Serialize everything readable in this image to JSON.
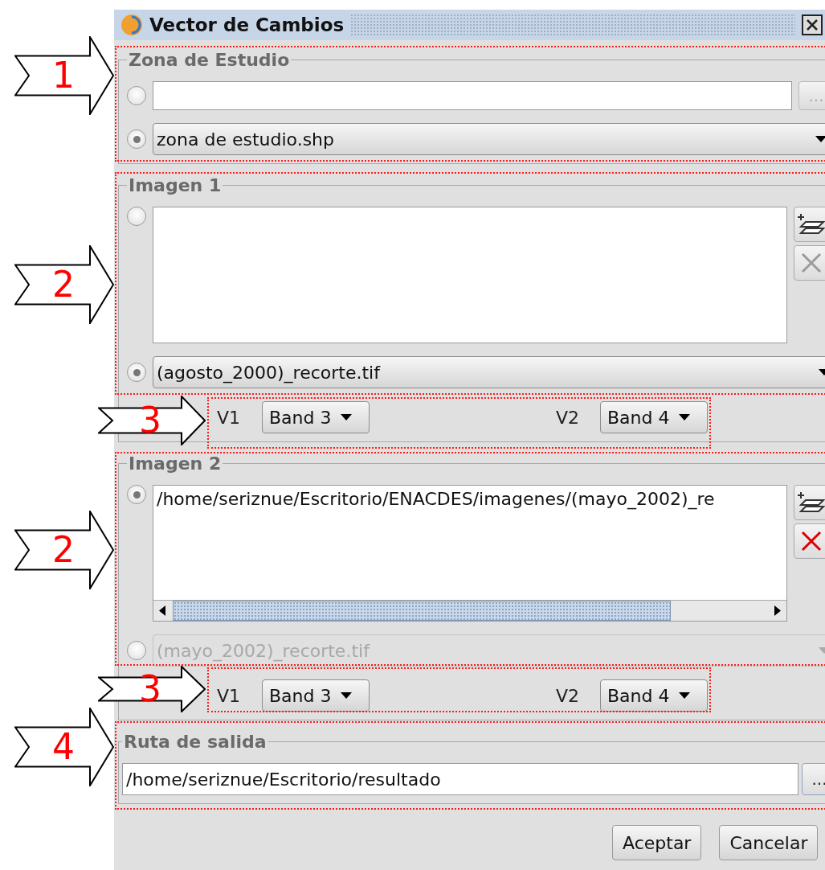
{
  "window": {
    "title": "Vector de Cambios"
  },
  "study_zone": {
    "title": "Zona de Estudio",
    "options": [
      {
        "kind": "file",
        "selected": false,
        "button": {
          "label": "...",
          "disabled": true
        }
      },
      {
        "kind": "combo",
        "selected": true,
        "value": "zona de estudio.shp"
      }
    ]
  },
  "images": [
    {
      "title": "Imagen 1",
      "list": {
        "selected": false,
        "remove_enabled": false,
        "scrollbar": false
      },
      "combo": {
        "selected": true,
        "disabled": false,
        "value": "(agosto_2000)_recorte.tif"
      },
      "bands": [
        {
          "label": "V1",
          "value": "Band 3"
        },
        {
          "label": "V2",
          "value": "Band 4"
        }
      ]
    },
    {
      "title": "Imagen 2",
      "list": {
        "selected": true,
        "remove_enabled": true,
        "scrollbar": true,
        "items": [
          "/home/seriznue/Escritorio/ENACDES/imagenes/(mayo_2002)_re"
        ]
      },
      "combo": {
        "selected": false,
        "disabled": true,
        "value": "(mayo_2002)_recorte.tif"
      },
      "bands": [
        {
          "label": "V1",
          "value": "Band 3"
        },
        {
          "label": "V2",
          "value": "Band 4"
        }
      ]
    }
  ],
  "output": {
    "title": "Ruta de salida",
    "value": "/home/seriznue/Escritorio/resultado",
    "button": {
      "label": "...",
      "disabled": false
    }
  },
  "buttons": [
    {
      "label": "Aceptar"
    },
    {
      "label": "Cancelar"
    }
  ],
  "annotations": [
    {
      "label": "1"
    },
    {
      "label": "2"
    },
    {
      "label": "3"
    },
    {
      "label": "2"
    },
    {
      "label": "3"
    },
    {
      "label": "4"
    }
  ]
}
